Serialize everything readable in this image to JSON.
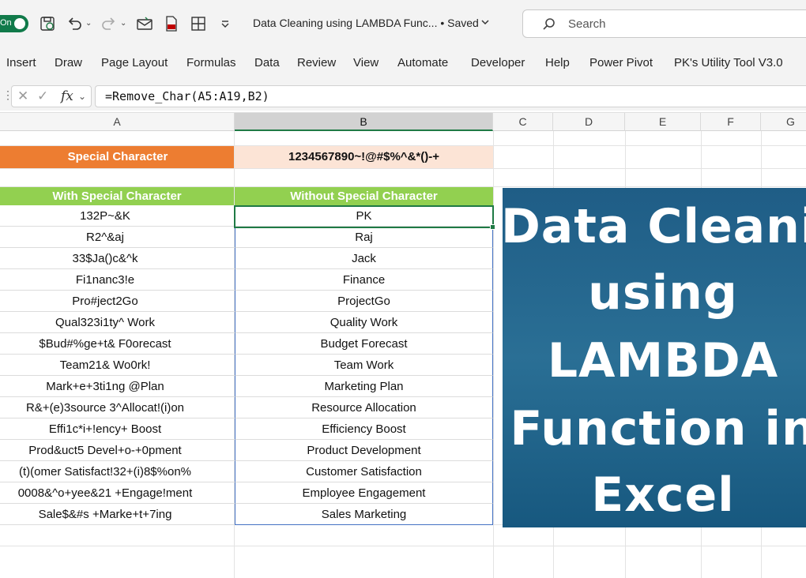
{
  "titlebar": {
    "autosave_label": "On",
    "document_title": "Data Cleaning using LAMBDA Func... • Saved",
    "search_placeholder": "Search"
  },
  "ribbon": {
    "tabs": [
      "Insert",
      "Draw",
      "Page Layout",
      "Formulas",
      "Data",
      "Review",
      "View",
      "Automate",
      "Developer",
      "Help",
      "Power Pivot",
      "PK's Utility Tool V3.0"
    ]
  },
  "formula_bar": {
    "fx_label": "fx",
    "formula": "=Remove_Char(A5:A19,B2)"
  },
  "columns": [
    "A",
    "B",
    "C",
    "D",
    "E",
    "F",
    "G"
  ],
  "sheet": {
    "special_label": "Special Character",
    "special_value": "1234567890~!@#$%^&*()-+",
    "header_a": "With Special Character",
    "header_b": "Without Special Character",
    "rows": [
      {
        "a": "132P~&K",
        "b": "PK"
      },
      {
        "a": "R2^&aj",
        "b": "Raj"
      },
      {
        "a": "33$Ja()c&^k",
        "b": "Jack"
      },
      {
        "a": "Fi1nanc3!e",
        "b": "Finance"
      },
      {
        "a": "Pro#ject2Go",
        "b": "ProjectGo"
      },
      {
        "a": "Qual323i1ty^ Work",
        "b": "Quality Work"
      },
      {
        "a": "$Bud#%ge+t& F0orecast",
        "b": "Budget Forecast"
      },
      {
        "a": "Team21& Wo0rk!",
        "b": "Team Work"
      },
      {
        "a": "Mark+e+3ti1ng @Plan",
        "b": "Marketing Plan"
      },
      {
        "a": "R&+(e)3source 3^Allocat!(i)on",
        "b": "Resource Allocation"
      },
      {
        "a": "Effi1c*i+!ency+ Boost",
        "b": "Efficiency Boost"
      },
      {
        "a": "Prod&uct5 Devel+o-+0pment",
        "b": "Product Development"
      },
      {
        "a": "(t)(omer Satisfact!32+(i)8$%on%",
        "b": "Customer Satisfaction"
      },
      {
        "a": "0008&^o+yee&21 +Engage!ment",
        "b": "Employee Engagement"
      },
      {
        "a": "Sale$&#s +Marke+t+7ing",
        "b": "Sales Marketing"
      }
    ]
  },
  "banner": {
    "lines": [
      "Data Cleanin",
      "using",
      "LAMBDA",
      "Function in",
      "Excel"
    ],
    "background": "#1f5d86"
  },
  "colors": {
    "orange": "#ed7d31",
    "peach": "#fce4d6",
    "green_header": "#92d050",
    "excel_green": "#1f7a45",
    "table_border": "#4472c4"
  }
}
